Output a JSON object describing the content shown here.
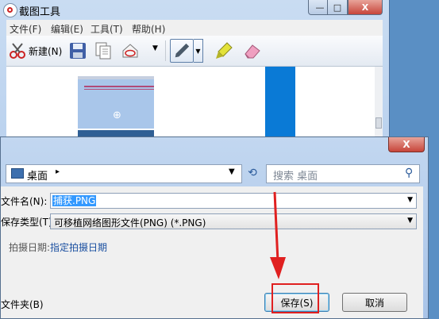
{
  "snip_window": {
    "title": "截图工具",
    "caption_buttons": {
      "minimize": "—",
      "maximize": "□",
      "close": "X"
    },
    "menu": [
      {
        "label": "文件(F)"
      },
      {
        "label": "编辑(E)"
      },
      {
        "label": "工具(T)"
      },
      {
        "label": "帮助(H)"
      }
    ],
    "toolbar": {
      "new_label": "新建(N)",
      "icons": [
        "scissors-icon",
        "save-icon",
        "copy-icon",
        "send-icon",
        "pen-icon",
        "highlighter-icon",
        "eraser-icon"
      ]
    }
  },
  "save_dialog": {
    "close": "X",
    "address": {
      "location": "桌面",
      "separator": "▸"
    },
    "refresh_icon": "⟲",
    "search": {
      "placeholder": "搜索 桌面",
      "icon": "⚲"
    },
    "filename_label": "文件名(N):",
    "filename_value": "捕获.PNG",
    "filetype_label": "保存类型(T):",
    "filetype_value": "可移植网络图形文件(PNG) (*.PNG)",
    "date_label": "拍摄日期:",
    "date_link": "指定拍摄日期",
    "hide_folders": "文件夹(B)",
    "save_button": "保存(S)",
    "cancel_button": "取消"
  },
  "colors": {
    "accent_blue": "#0a7ad6",
    "annotation_red": "#e02020",
    "selection": "#3399ff"
  }
}
